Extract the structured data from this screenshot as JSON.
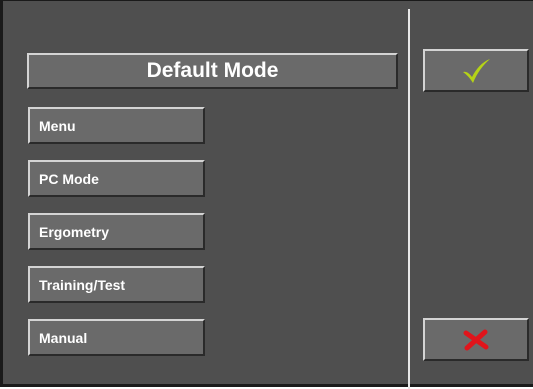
{
  "title": "Default Mode",
  "modes": [
    {
      "label": "Menu"
    },
    {
      "label": "PC Mode"
    },
    {
      "label": "Ergometry"
    },
    {
      "label": "Training/Test"
    },
    {
      "label": "Manual"
    }
  ],
  "actions": {
    "confirm": {
      "icon": "checkmark-icon",
      "color": "#b5d316"
    },
    "cancel": {
      "icon": "cross-icon",
      "color": "#e0141b"
    }
  },
  "colors": {
    "background": "#4f4f4f",
    "button": "#6a6a6a",
    "text": "#ffffff"
  }
}
